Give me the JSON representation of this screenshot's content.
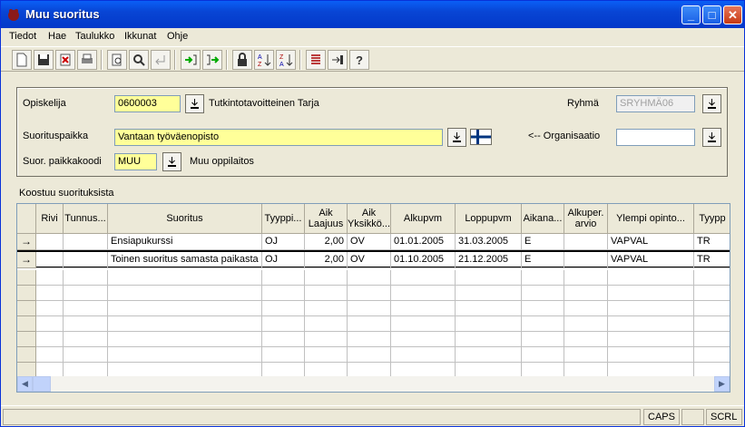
{
  "window": {
    "title": "Muu suoritus"
  },
  "menu": [
    "Tiedot",
    "Hae",
    "Taulukko",
    "Ikkunat",
    "Ohje"
  ],
  "form": {
    "opiskelija_label": "Opiskelija",
    "opiskelija_value": "0600003",
    "opiskelija_name": "Tutkintotavoitteinen Tarja",
    "ryhma_label": "Ryhmä",
    "ryhma_value": "SRYHMÄ06",
    "suorituspaikka_label": "Suorituspaikka",
    "suorituspaikka_value": "Vantaan työväenopisto",
    "organisaatio_label": "<-- Organisaatio",
    "organisaatio_value": "",
    "paikkakoodi_label": "Suor. paikkakoodi",
    "paikkakoodi_value": "MUU",
    "paikkakoodi_desc": "Muu oppilaitos"
  },
  "grid": {
    "caption": "Koostuu suorituksista",
    "columns": [
      "Rivi",
      "Tunnus...",
      "Suoritus",
      "Tyyppi...",
      "Aik Laajuus",
      "Aik Yksikkö...",
      "Alkupvm",
      "Loppupvm",
      "Aikana...",
      "Alkuper. arvio",
      "Ylempi opinto...",
      "Tyypp"
    ],
    "rows": [
      {
        "indicator": "→",
        "rivi": "",
        "tunnus": "",
        "suoritus": "Ensiapukurssi",
        "tyyppi": "OJ",
        "laajuus": "2,00",
        "yksikko": "OV",
        "alkupvm": "01.01.2005",
        "loppupvm": "31.03.2005",
        "aikana": "E",
        "arvio": "",
        "ylempi": "VAPVAL",
        "tyypp": "TR"
      },
      {
        "indicator": "→",
        "rivi": "",
        "tunnus": "",
        "suoritus": "Toinen suoritus samasta paikasta",
        "tyyppi": "OJ",
        "laajuus": "2,00",
        "yksikko": "OV",
        "alkupvm": "01.10.2005",
        "loppupvm": "21.12.2005",
        "aikana": "E",
        "arvio": "",
        "ylempi": "VAPVAL",
        "tyypp": "TR"
      }
    ]
  },
  "status": {
    "caps": "CAPS",
    "scrl": "SCRL"
  }
}
